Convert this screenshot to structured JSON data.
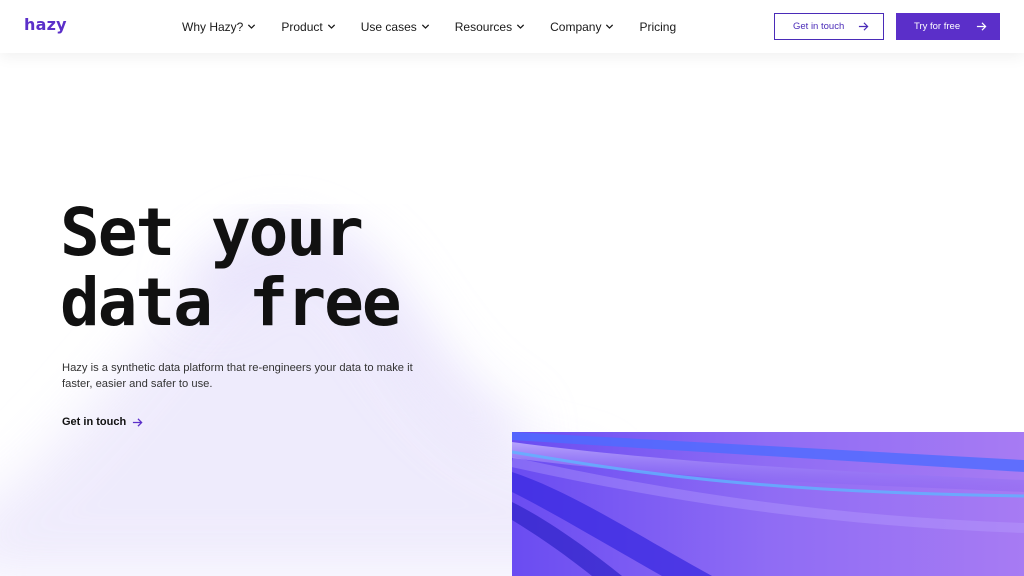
{
  "brand": {
    "logo_text": "hazy",
    "accent": "#5b2fc9"
  },
  "nav": {
    "items": [
      {
        "label": "Why Hazy?",
        "has_dropdown": true
      },
      {
        "label": "Product",
        "has_dropdown": true
      },
      {
        "label": "Use cases",
        "has_dropdown": true
      },
      {
        "label": "Resources",
        "has_dropdown": true
      },
      {
        "label": "Company",
        "has_dropdown": true
      },
      {
        "label": "Pricing",
        "has_dropdown": false
      }
    ],
    "get_in_touch_label": "Get in touch",
    "try_free_label": "Try for free"
  },
  "hero": {
    "title_line1": "Set your",
    "title_line2": "data free",
    "description": "Hazy is a synthetic data platform that re-engineers your data to make it faster, easier and safer to use.",
    "cta_label": "Get in touch"
  },
  "icons": {
    "nav_dropdown": "chevron-down-icon",
    "cta": "arrow-right-icon"
  }
}
